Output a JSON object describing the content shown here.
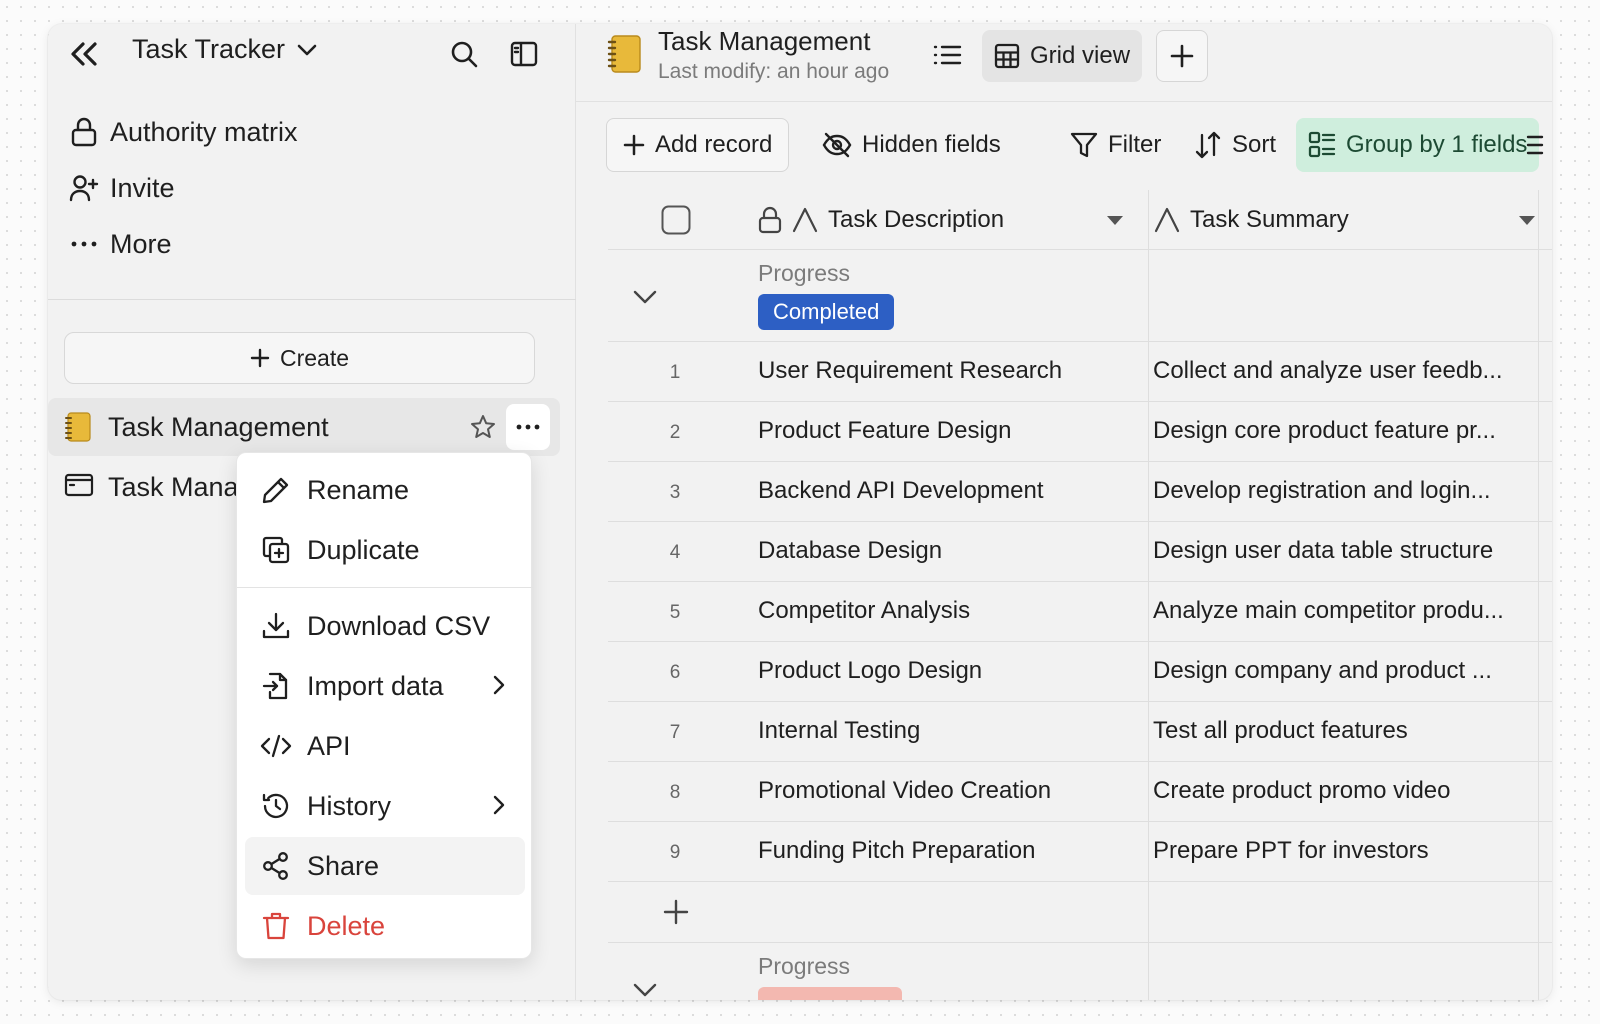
{
  "sidebar": {
    "title": "Task Tracker",
    "nav": [
      {
        "label": "Authority matrix",
        "icon": "lock-icon"
      },
      {
        "label": "Invite",
        "icon": "user-plus-icon"
      },
      {
        "label": "More",
        "icon": "more-horizontal-icon"
      }
    ],
    "create_label": "Create",
    "tables": [
      {
        "label": "Task Management",
        "icon": "notebook-icon"
      },
      {
        "label": "Task Mana",
        "icon": "form-icon"
      }
    ]
  },
  "context_menu": {
    "items": [
      {
        "label": "Rename",
        "icon": "pencil-icon"
      },
      {
        "label": "Duplicate",
        "icon": "duplicate-icon"
      },
      {
        "label": "Download CSV",
        "icon": "download-icon"
      },
      {
        "label": "Import data",
        "icon": "import-icon"
      },
      {
        "label": "API",
        "icon": "code-icon"
      },
      {
        "label": "History",
        "icon": "history-icon"
      },
      {
        "label": "Share",
        "icon": "share-icon"
      },
      {
        "label": "Delete",
        "icon": "trash-icon"
      }
    ]
  },
  "header": {
    "title": "Task Management",
    "subtitle": "Last modify: an hour ago",
    "view_label": "Grid view"
  },
  "toolbar": {
    "add_record": "Add record",
    "hidden_fields": "Hidden fields",
    "filter": "Filter",
    "sort": "Sort",
    "group_by": "Group by 1 fields"
  },
  "grid": {
    "columns": [
      "Task Description",
      "Task Summary"
    ],
    "group_field": "Progress",
    "groups": [
      {
        "value": "Completed",
        "color": "#2d5fc4"
      }
    ],
    "rows": [
      {
        "num": "1",
        "desc": "User Requirement Research",
        "summary": "Collect and analyze user feedb..."
      },
      {
        "num": "2",
        "desc": "Product Feature Design",
        "summary": "Design core product feature pr..."
      },
      {
        "num": "3",
        "desc": "Backend API Development",
        "summary": "Develop registration and login..."
      },
      {
        "num": "4",
        "desc": "Database Design",
        "summary": "Design user data table structure"
      },
      {
        "num": "5",
        "desc": "Competitor Analysis",
        "summary": "Analyze main competitor produ..."
      },
      {
        "num": "6",
        "desc": "Product Logo Design",
        "summary": "Design company and product ..."
      },
      {
        "num": "7",
        "desc": "Internal Testing",
        "summary": "Test all product features"
      },
      {
        "num": "8",
        "desc": "Promotional Video Creation",
        "summary": "Create product promo video"
      },
      {
        "num": "9",
        "desc": "Funding Pitch Preparation",
        "summary": "Prepare PPT for investors"
      }
    ]
  }
}
